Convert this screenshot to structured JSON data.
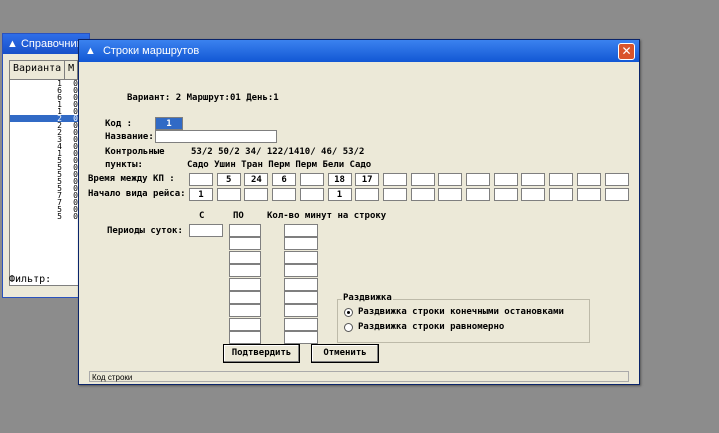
{
  "background_window": {
    "title": "Справочник",
    "col1_header": "Варианта",
    "col2_header": "М",
    "rows": [
      {
        "v": "1",
        "m": "0"
      },
      {
        "v": "6",
        "m": "0"
      },
      {
        "v": "6",
        "m": "0"
      },
      {
        "v": "1",
        "m": "0"
      },
      {
        "v": "1",
        "m": "0"
      },
      {
        "v": "2",
        "m": "0",
        "selected": true
      },
      {
        "v": "2",
        "m": "0"
      },
      {
        "v": "2",
        "m": "0"
      },
      {
        "v": "3",
        "m": "0"
      },
      {
        "v": "4",
        "m": "0"
      },
      {
        "v": "1",
        "m": "0"
      },
      {
        "v": "5",
        "m": "0"
      },
      {
        "v": "5",
        "m": "0"
      },
      {
        "v": "5",
        "m": "0"
      },
      {
        "v": "5",
        "m": "0"
      },
      {
        "v": "5",
        "m": "0"
      },
      {
        "v": "7",
        "m": "0"
      },
      {
        "v": "7",
        "m": "0"
      },
      {
        "v": "5",
        "m": "0"
      },
      {
        "v": "5",
        "m": "0"
      }
    ],
    "filter_label": "Фильтр:"
  },
  "dialog": {
    "title": "Строки маршрутов",
    "close_glyph": "✕",
    "header_line": "Вариант: 2 Маршрут:01    День:1",
    "kod_label": "Код      :",
    "kod_value": "1",
    "name_label": "Название:",
    "name_value": "",
    "control_label": "Контрольные",
    "control_values": "53/2 50/2 34/ 122/1410/  46/  53/2",
    "points_label": "пункты:",
    "points_values": "Садо Ушин Тран Перм Перм Бели Садо",
    "interval_label": "Время между КП   :",
    "interval_values": [
      "",
      "5",
      "24",
      "6",
      "",
      "18",
      "17",
      "",
      "",
      "",
      "",
      "",
      "",
      "",
      "",
      ""
    ],
    "start_label": "Начало вида рейса:",
    "start_values": [
      "1",
      "",
      "",
      "",
      "",
      "1",
      "",
      "",
      "",
      "",
      "",
      "",
      "",
      "",
      "",
      ""
    ],
    "col_from": "С",
    "col_to": "ПО",
    "col_minutes": "Кол-во минут на строку",
    "periods_label": "Периоды суток:",
    "group_title": "Раздвижка",
    "radio1": "Раздвижка строки конечными остановками",
    "radio2": "Раздвижка строки равномерно",
    "confirm_button": "Подтвердить",
    "cancel_button": "Отменить",
    "status_text": "Код строки"
  }
}
